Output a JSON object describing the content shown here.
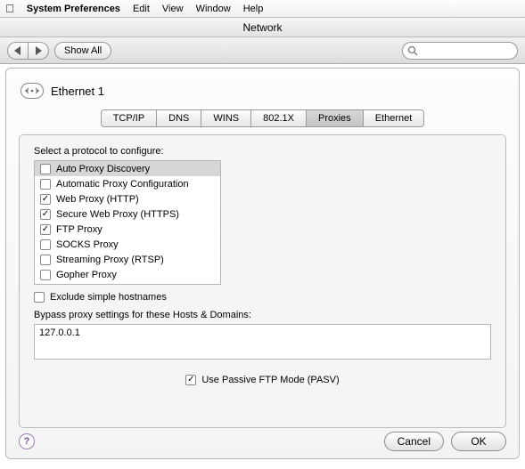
{
  "menubar": {
    "app": "System Preferences",
    "items": [
      "Edit",
      "View",
      "Window",
      "Help"
    ]
  },
  "window": {
    "title": "Network",
    "show_all": "Show All",
    "search_placeholder": ""
  },
  "interface": {
    "name": "Ethernet 1"
  },
  "tabs": [
    "TCP/IP",
    "DNS",
    "WINS",
    "802.1X",
    "Proxies",
    "Ethernet"
  ],
  "active_tab": "Proxies",
  "proxies": {
    "select_label": "Select a protocol to configure:",
    "list": [
      {
        "label": "Auto Proxy Discovery",
        "checked": false,
        "selected": true
      },
      {
        "label": "Automatic Proxy Configuration",
        "checked": false,
        "selected": false
      },
      {
        "label": "Web Proxy (HTTP)",
        "checked": true,
        "selected": false
      },
      {
        "label": "Secure Web Proxy (HTTPS)",
        "checked": true,
        "selected": false
      },
      {
        "label": "FTP Proxy",
        "checked": true,
        "selected": false
      },
      {
        "label": "SOCKS Proxy",
        "checked": false,
        "selected": false
      },
      {
        "label": "Streaming Proxy (RTSP)",
        "checked": false,
        "selected": false
      },
      {
        "label": "Gopher Proxy",
        "checked": false,
        "selected": false
      }
    ],
    "exclude_simple": {
      "label": "Exclude simple hostnames",
      "checked": false
    },
    "bypass_label": "Bypass proxy settings for these Hosts & Domains:",
    "bypass_value": "127.0.0.1",
    "pasv": {
      "label": "Use Passive FTP Mode (PASV)",
      "checked": true
    }
  },
  "buttons": {
    "cancel": "Cancel",
    "ok": "OK"
  }
}
